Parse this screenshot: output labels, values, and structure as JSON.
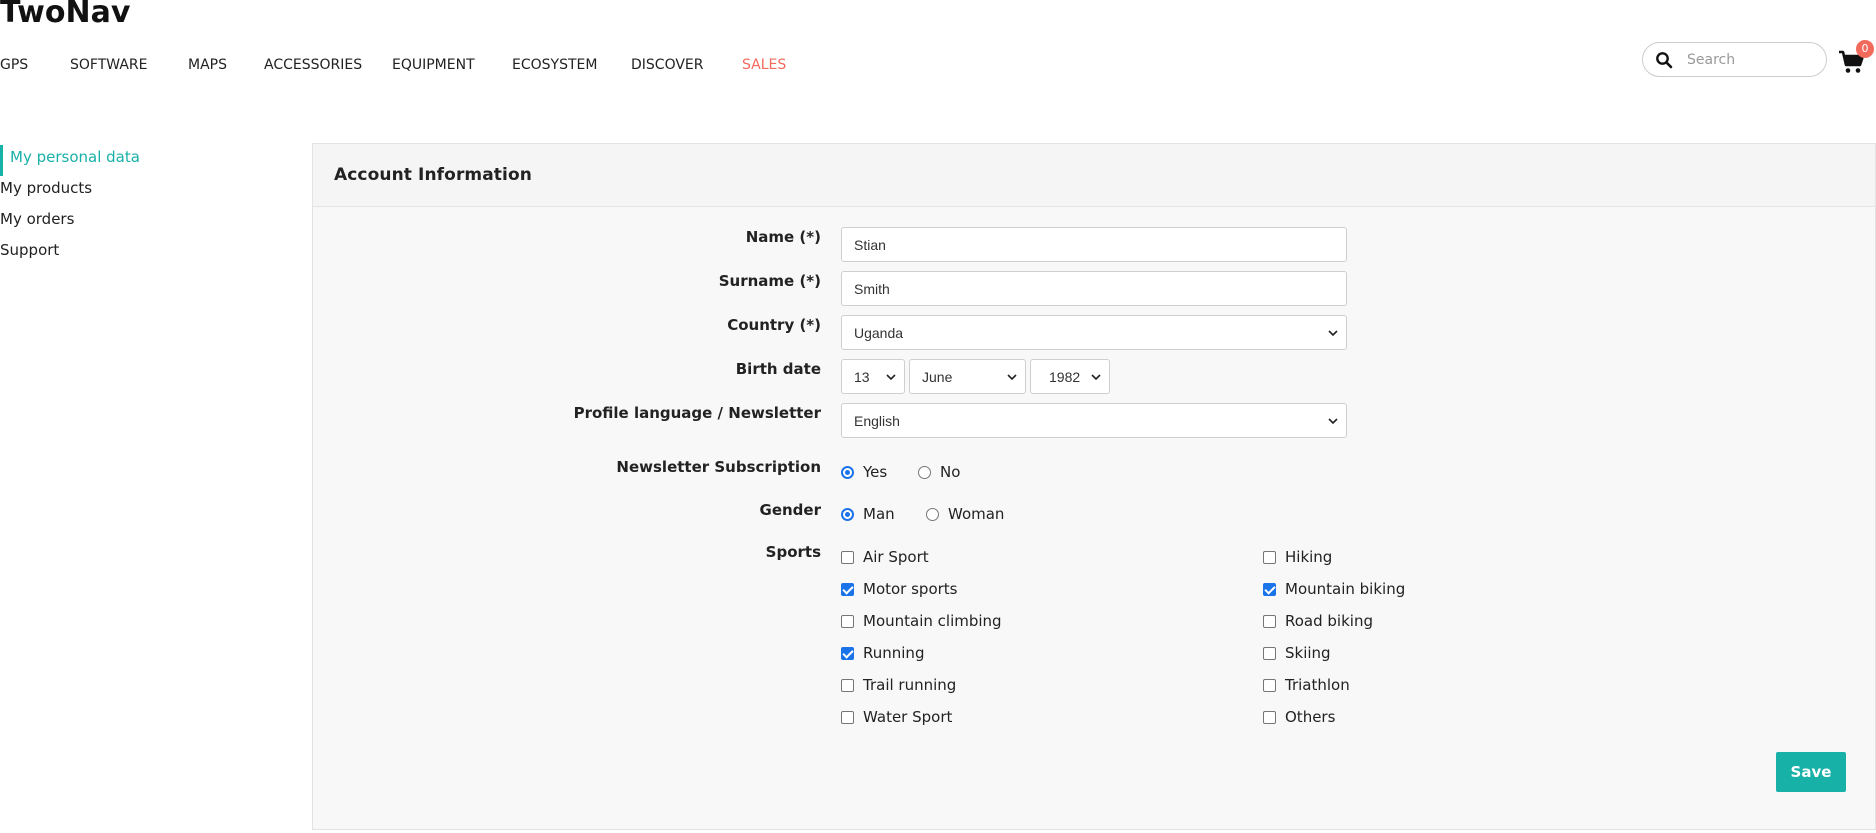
{
  "header": {
    "logo": "TwoNav",
    "nav": [
      {
        "label": "GPS"
      },
      {
        "label": "SOFTWARE"
      },
      {
        "label": "MAPS"
      },
      {
        "label": "ACCESSORIES"
      },
      {
        "label": "EQUIPMENT"
      },
      {
        "label": "ECOSYSTEM"
      },
      {
        "label": "DISCOVER"
      },
      {
        "label": "SALES"
      }
    ],
    "search_placeholder": "Search",
    "cart_count": "0",
    "colors": {
      "sales": "#f26a5c",
      "badge": "#f26a5c"
    }
  },
  "sidebar": {
    "items": [
      {
        "label": "My personal data"
      },
      {
        "label": "My products"
      },
      {
        "label": "My orders"
      },
      {
        "label": "Support"
      }
    ],
    "active_color": "#18b1a8"
  },
  "panel": {
    "title": "Account Information",
    "fields": {
      "name": {
        "label": "Name (*)",
        "value": "Stian"
      },
      "surname": {
        "label": "Surname (*)",
        "value": "Smith"
      },
      "country": {
        "label": "Country (*)",
        "value": "Uganda"
      },
      "birth": {
        "label": "Birth date",
        "day": "13",
        "month": "June",
        "year": "1982"
      },
      "language": {
        "label": "Profile language / Newsletter",
        "value": "English"
      },
      "newsletter": {
        "label": "Newsletter Subscription",
        "yes": "Yes",
        "no": "No"
      },
      "gender": {
        "label": "Gender",
        "man": "Man",
        "woman": "Woman"
      },
      "sports": {
        "label": "Sports",
        "items": [
          {
            "label": "Air Sport"
          },
          {
            "label": "Hiking"
          },
          {
            "label": "Motor sports"
          },
          {
            "label": "Mountain biking"
          },
          {
            "label": "Mountain climbing"
          },
          {
            "label": "Road biking"
          },
          {
            "label": "Running"
          },
          {
            "label": "Skiing"
          },
          {
            "label": "Trail running"
          },
          {
            "label": "Triathlon"
          },
          {
            "label": "Water Sport"
          },
          {
            "label": "Others"
          }
        ]
      }
    },
    "save_label": "Save",
    "accent_color": "#18b1a8"
  }
}
